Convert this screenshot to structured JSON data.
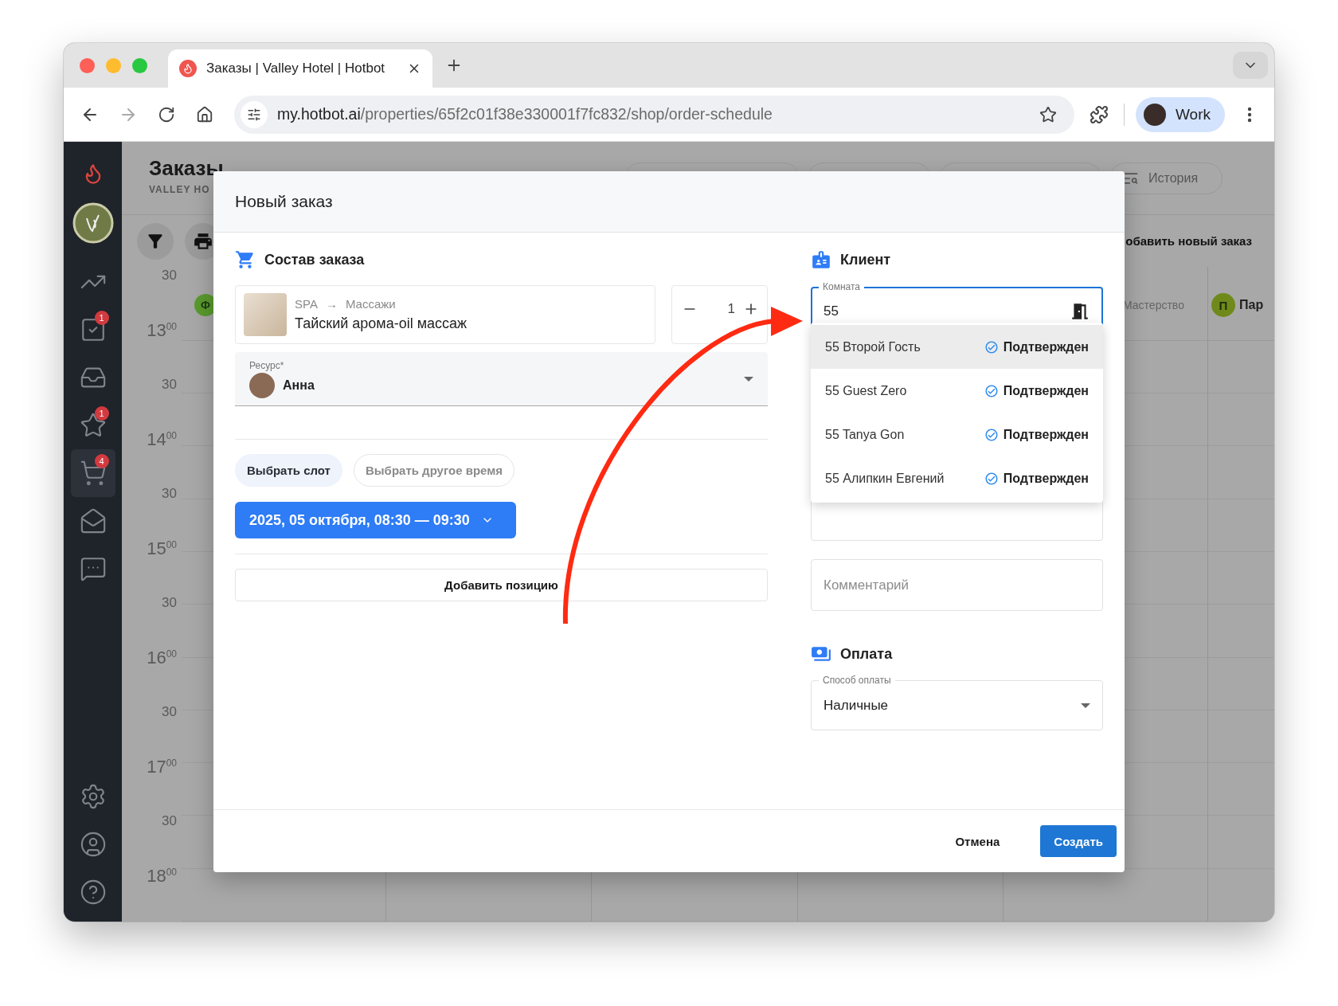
{
  "browser": {
    "tab": {
      "title": "Заказы | Valley Hotel | Hotbot",
      "selected": true
    },
    "url": {
      "host": "my.hotbot.ai",
      "path": "/properties/65f2c01f38e330001f7fc832/shop/order-schedule"
    },
    "profile": {
      "label": "Work"
    }
  },
  "sidebar": {
    "items": [
      {
        "selected": false
      },
      {
        "badge": "1",
        "selected": false
      },
      {
        "selected": false
      },
      {
        "badge": "1",
        "selected": false
      },
      {
        "badge": "4",
        "selected": true
      },
      {
        "selected": false
      },
      {
        "selected": false
      }
    ]
  },
  "page": {
    "title": "Заказы",
    "subtitle": "VALLEY HO",
    "history_button": "История",
    "add_order_link": "обавить новый заказ"
  },
  "calendar": {
    "times": [
      "30",
      "13$^{00}$",
      "30",
      "14$^{00}$",
      "30",
      "15$^{00}$",
      "30",
      "16$^{00}$",
      "30",
      "17$^{00}$",
      "30",
      "18$^{00}$"
    ],
    "left_avatar": "Ф",
    "heading": "Мастерство",
    "right_resource": {
      "avatar": "П",
      "name": "Пар"
    }
  },
  "modal": {
    "title": "Новый заказ",
    "order": {
      "heading": "Состав заказа",
      "item": {
        "category": "SPA",
        "arrow": "→",
        "subcategory": "Массажи",
        "name": "Тайский арома-oil массаж",
        "qty": "1"
      },
      "resource": {
        "label": "Ресурс*",
        "value": "Анна"
      },
      "slot_modes": [
        {
          "label": "Выбрать слот",
          "selected": true
        },
        {
          "label": "Выбрать другое время",
          "selected": false
        }
      ],
      "slot": "2025, 05 октября, 08:30 — 09:30",
      "add_button": "Добавить позицию"
    },
    "client": {
      "heading": "Клиент",
      "room": {
        "label": "Комната",
        "value": "55"
      },
      "suggestions": [
        {
          "name": "55 Второй Гость",
          "status": "Подтвержден",
          "selected": true
        },
        {
          "name": "55 Guest Zero",
          "status": "Подтвержден",
          "selected": false
        },
        {
          "name": "55 Tanya Gon",
          "status": "Подтвержден",
          "selected": false
        },
        {
          "name": "55 Алипкин Евгений",
          "status": "Подтвержден",
          "selected": false
        }
      ],
      "comment": {
        "placeholder": "Комментарий"
      }
    },
    "payment": {
      "heading": "Оплата",
      "method": {
        "label": "Способ оплаты",
        "value": "Наличные"
      }
    },
    "buttons": [
      {
        "label": "Отмена",
        "kind": "text"
      },
      {
        "label": "Создать",
        "kind": "primary"
      }
    ]
  }
}
